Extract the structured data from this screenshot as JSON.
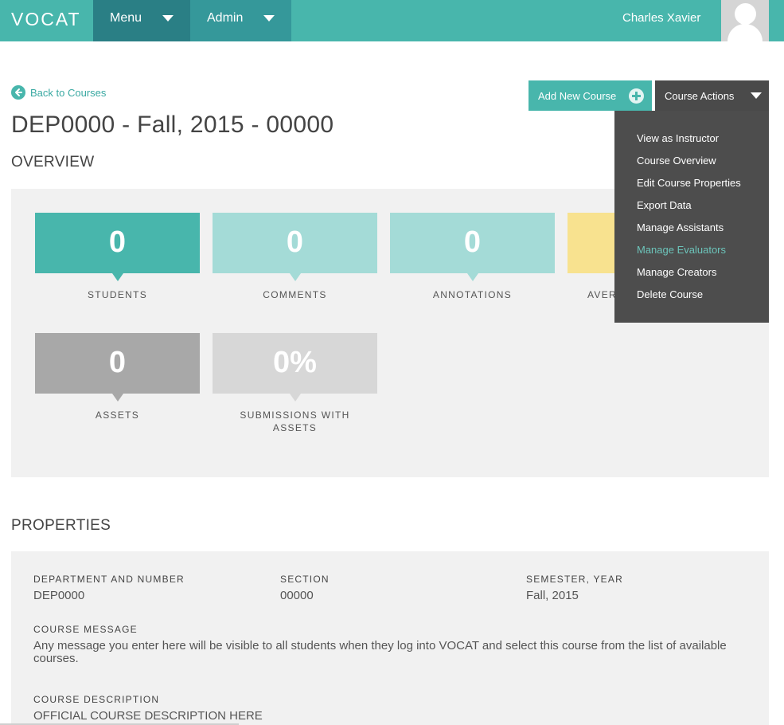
{
  "nav": {
    "logo": "VOCAT",
    "menu_label": "Menu",
    "admin_label": "Admin",
    "user_name": "Charles Xavier"
  },
  "header": {
    "back_link": "Back to Courses",
    "title": "DEP0000 - Fall, 2015 - 00000",
    "add_course_label": "Add New Course",
    "course_actions_label": "Course Actions"
  },
  "course_actions_menu": {
    "items": [
      {
        "label": "View as Instructor",
        "active": false
      },
      {
        "label": "Course Overview",
        "active": false
      },
      {
        "label": "Edit Course Properties",
        "active": false
      },
      {
        "label": "Export Data",
        "active": false
      },
      {
        "label": "Manage Assistants",
        "active": false
      },
      {
        "label": "Manage Evaluators",
        "active": true
      },
      {
        "label": "Manage Creators",
        "active": false
      },
      {
        "label": "Delete Course",
        "active": false
      }
    ]
  },
  "overview": {
    "heading": "OVERVIEW",
    "stats": [
      {
        "value": "0",
        "label": "STUDENTS",
        "color": "#48b6ac"
      },
      {
        "value": "0",
        "label": "COMMENTS",
        "color": "#a4dbd7"
      },
      {
        "value": "0",
        "label": "ANNOTATIONS",
        "color": "#a4dbd7"
      },
      {
        "value": "",
        "label": "AVER",
        "color": "#f8e28f"
      },
      {
        "value": "0",
        "label": "ASSETS",
        "color": "#a8a8a8"
      },
      {
        "value": "0%",
        "label": "SUBMISSIONS WITH ASSETS",
        "color": "#d7d7d7"
      }
    ]
  },
  "properties": {
    "heading": "PROPERTIES",
    "department_label": "DEPARTMENT AND NUMBER",
    "department_value": "DEP0000",
    "section_label": "SECTION",
    "section_value": "00000",
    "semester_label": "SEMESTER, YEAR",
    "semester_value": "Fall, 2015",
    "message_label": "COURSE MESSAGE",
    "message_value": "Any message you enter here will be visible to all students when they log into VOCAT and select this course from the list of available courses.",
    "description_label": "COURSE DESCRIPTION",
    "description_value": "OFFICIAL COURSE DESCRIPTION HERE"
  },
  "colors": {
    "brand": "#48b6ac",
    "nav_dark": "#2a7f85",
    "dropdown_bg": "#4d4d4d",
    "dropdown_active": "#6cc4ba"
  }
}
